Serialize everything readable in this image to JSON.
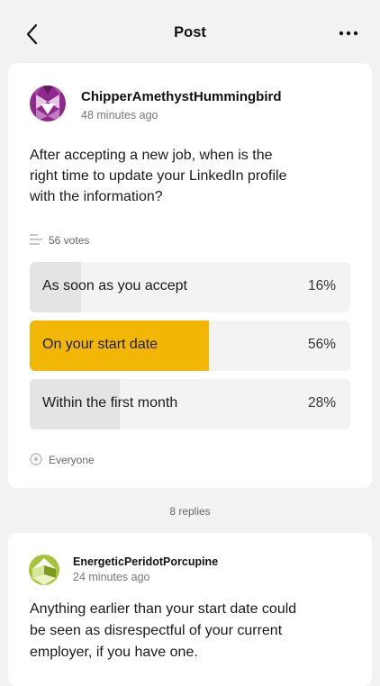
{
  "header": {
    "title": "Post",
    "back_icon": "chevron-left-icon",
    "more_icon": "more-horizontal-icon"
  },
  "post": {
    "author": "ChipperAmethystHummingbird",
    "time": "48 minutes ago",
    "avatar_color": "#8e2a8b",
    "question_lines": [
      "After accepting a new job, when is the",
      "right time to update your LinkedIn profile",
      "with the information?"
    ],
    "votes": "56 votes",
    "options": [
      {
        "label": "As soon as you accept",
        "percent_text": "16%",
        "percent": 16,
        "selected": false
      },
      {
        "label": "On your start date",
        "percent_text": "56%",
        "percent": 56,
        "selected": true
      },
      {
        "label": "Within the first month",
        "percent_text": "28%",
        "percent": 28,
        "selected": false
      }
    ],
    "audience": "Everyone",
    "accent": "#f2b705"
  },
  "replies_count": "8 replies",
  "reply": {
    "author": "EnergeticPeridotPorcupine",
    "time": "24 minutes ago",
    "avatar_color": "#a6c43a",
    "text_lines": [
      "Anything earlier than your start date could",
      "be seen as disrespectful of your current",
      "employer, if you have one."
    ]
  }
}
